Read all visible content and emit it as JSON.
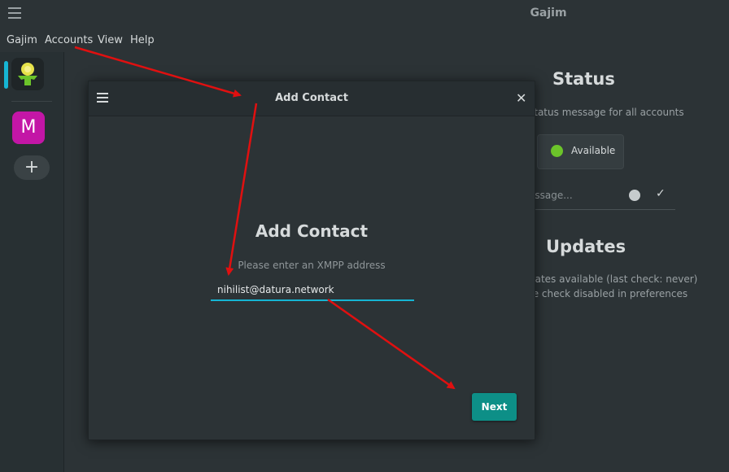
{
  "window": {
    "title": "Gajim"
  },
  "menubar": {
    "items": [
      "Gajim",
      "Accounts",
      "View",
      "Help"
    ]
  },
  "sidebar": {
    "account_letter": "M",
    "add_symbol": "+"
  },
  "background": {
    "status_title": "Status",
    "status_subtitle": "status message for all accounts",
    "status_value": "Available",
    "message_placeholder": "essage...",
    "updates_title": "Updates",
    "updates_line1": "dates available (last check: never)",
    "updates_line2": "te check disabled in preferences",
    "available_color": "#6cc42a"
  },
  "dialog": {
    "header_title": "Add Contact",
    "heading": "Add Contact",
    "subtitle": "Please enter an XMPP address",
    "input_value": "nihilist@datura.network",
    "next_label": "Next",
    "close_symbol": "✕",
    "accent_color": "#16b5d4",
    "button_color": "#0d8f87"
  },
  "annotation_color": "#e01010"
}
